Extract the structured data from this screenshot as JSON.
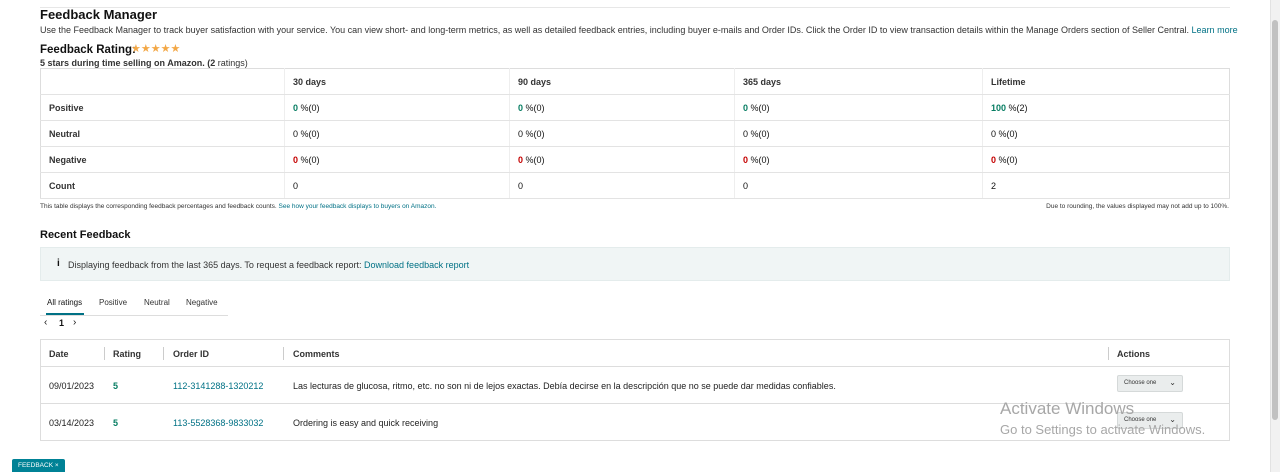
{
  "header": {
    "title": "Feedback Manager",
    "intro": "Use the Feedback Manager to track buyer satisfaction with your service. You can view short- and long-term metrics, as well as detailed feedback entries, including buyer e-mails and Order IDs. Click the Order ID to view transaction details within the Manage Orders section of Seller Central.",
    "learn_more": "Learn more"
  },
  "rating": {
    "label": "Feedback Rating:",
    "stars": "★★★★★",
    "stars_value": 5,
    "sub_prefix": "5 stars during time selling on Amazon. (",
    "sub_count": "2",
    "sub_suffix": " ratings)"
  },
  "summary": {
    "columns": [
      "30 days",
      "90 days",
      "365 days",
      "Lifetime"
    ],
    "rows": [
      {
        "label": "Positive",
        "cells": [
          {
            "v": "0",
            "u": "%(0)"
          },
          {
            "v": "0",
            "u": "%(0)"
          },
          {
            "v": "0",
            "u": "%(0)"
          },
          {
            "v": "100",
            "u": "%(2)"
          }
        ]
      },
      {
        "label": "Neutral",
        "cells": [
          {
            "v": "0",
            "u": "%(0)"
          },
          {
            "v": "0",
            "u": "%(0)"
          },
          {
            "v": "0",
            "u": "%(0)"
          },
          {
            "v": "0",
            "u": "%(0)"
          }
        ]
      },
      {
        "label": "Negative",
        "cells": [
          {
            "v": "0",
            "u": "%(0)"
          },
          {
            "v": "0",
            "u": "%(0)"
          },
          {
            "v": "0",
            "u": "%(0)"
          },
          {
            "v": "0",
            "u": "%(0)"
          }
        ]
      },
      {
        "label": "Count",
        "cells": [
          {
            "v": "0",
            "u": ""
          },
          {
            "v": "0",
            "u": ""
          },
          {
            "v": "0",
            "u": ""
          },
          {
            "v": "2",
            "u": ""
          }
        ]
      }
    ],
    "note_left": "This table displays the corresponding feedback percentages and feedback counts.",
    "note_left_link": "See how your feedback displays to buyers on Amazon.",
    "note_right": "Due to rounding, the values displayed may not add up to 100%."
  },
  "recent": {
    "title": "Recent Feedback",
    "info_icon": "info-icon",
    "info_text": "Displaying feedback from the last 365 days. To request a feedback report:",
    "info_link": "Download feedback report",
    "tabs": [
      "All ratings",
      "Positive",
      "Neutral",
      "Negative"
    ],
    "pager": {
      "prev": "‹",
      "page": "1",
      "next": "›"
    },
    "headers": {
      "date": "Date",
      "rating": "Rating",
      "order": "Order ID",
      "comments": "Comments",
      "actions": "Actions"
    },
    "rows": [
      {
        "date": "09/01/2023",
        "rating": "5",
        "order": "112-3141288-1320212",
        "comment": "Las lecturas de glucosa, ritmo, etc. no son ni de lejos exactas. Debía decirse en la descripción que no se puede dar medidas confiables.",
        "action": "Choose one"
      },
      {
        "date": "03/14/2023",
        "rating": "5",
        "order": "113-5528368-9833032",
        "comment": "Ordering is easy and quick receiving",
        "action": "Choose one"
      }
    ]
  },
  "watermark": {
    "line1": "Activate Windows",
    "line2": "Go to Settings to activate Windows."
  },
  "feedback_tab": "FEEDBACK ×",
  "colors": {
    "accent": "#007185",
    "positive": "#067d62",
    "negative": "#c40000",
    "star": "#f3a847",
    "tag": "#008296"
  }
}
